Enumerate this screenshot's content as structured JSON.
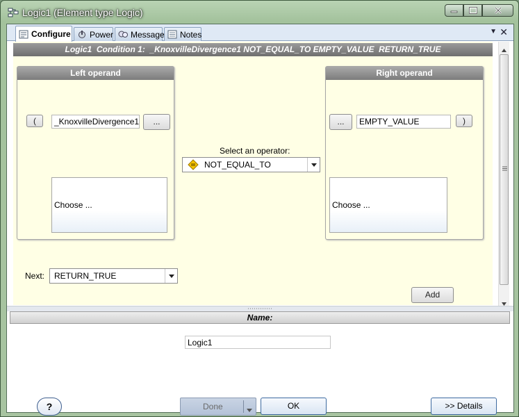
{
  "window": {
    "title": "Logic1 (Element type Logic)"
  },
  "tabs": [
    {
      "label": "Configure",
      "icon": "configure-icon",
      "active": true
    },
    {
      "label": "Power",
      "icon": "power-icon",
      "active": false
    },
    {
      "label": "Message",
      "icon": "message-icon",
      "active": false
    },
    {
      "label": "Notes",
      "icon": "notes-icon",
      "active": false
    }
  ],
  "condition": {
    "header": "Logic1  Condition 1:  _KnoxvilleDivergence1 NOT_EQUAL_TO EMPTY_VALUE  RETURN_TRUE"
  },
  "left_operand": {
    "title": "Left operand",
    "paren": "(",
    "value": "_KnoxvilleDivergence1",
    "browse_label": "...",
    "choose_label": "Choose ..."
  },
  "operator": {
    "prompt": "Select an operator:",
    "value": "NOT_EQUAL_TO"
  },
  "right_operand": {
    "title": "Right operand",
    "paren": ")",
    "value": "EMPTY_VALUE",
    "browse_label": "...",
    "choose_label": "Choose ..."
  },
  "next": {
    "label": "Next:",
    "value": "RETURN_TRUE"
  },
  "add_label": "Add",
  "name_section": {
    "title": "Name:",
    "value": "Logic1"
  },
  "footer": {
    "help_label": "?",
    "done_label": "Done",
    "ok_label": "OK",
    "details_label": ">> Details"
  },
  "colors": {
    "config_bg": "#ffffe5",
    "header_gray": "#7c7c7c",
    "title_bar": "#a3c29c"
  }
}
